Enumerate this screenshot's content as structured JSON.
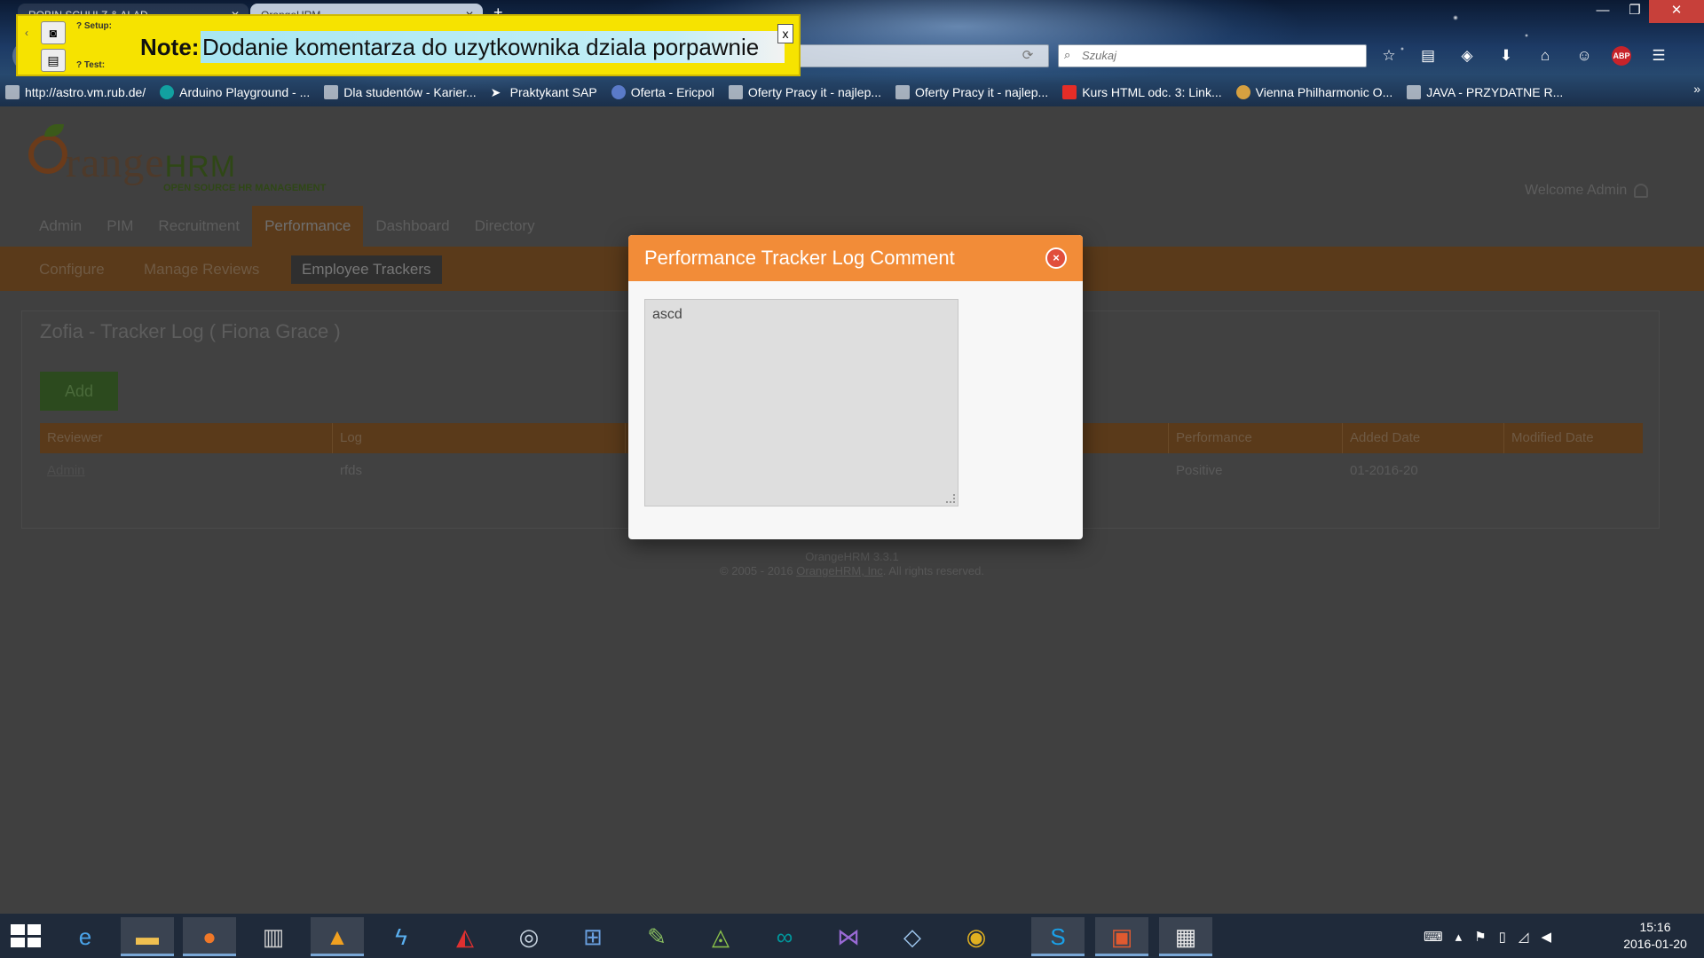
{
  "browser": {
    "tabs": [
      {
        "title": "ROBIN SCHULZ & ALAD..."
      },
      {
        "title": "OrangeHRM"
      }
    ],
    "new_tab": "+",
    "window_controls": {
      "minimize": "—",
      "maximize": "❐",
      "close": "✕"
    },
    "search_placeholder": "Szukaj",
    "bookmarks": [
      {
        "label": "http://astro.vm.rub.de/",
        "icon": "page-icon"
      },
      {
        "label": "Arduino Playground - ...",
        "icon": "arduino-icon"
      },
      {
        "label": "Dla studentów - Karier...",
        "icon": "page-icon"
      },
      {
        "label": "Praktykant SAP",
        "icon": "arrow-icon"
      },
      {
        "label": "Oferta - Ericpol",
        "icon": "butterfly-icon"
      },
      {
        "label": "Oferty Pracy it - najlep...",
        "icon": "page-icon"
      },
      {
        "label": "Oferty Pracy it - najlep...",
        "icon": "page-icon"
      },
      {
        "label": "Kurs HTML odc. 3: Link...",
        "icon": "youtube-icon"
      },
      {
        "label": "Vienna Philharmonic O...",
        "icon": "orb-icon"
      },
      {
        "label": "JAVA - PRZYDATNE R...",
        "icon": "page-icon"
      }
    ],
    "bookmarks_more": "»"
  },
  "note": {
    "setup_label": "? Setup:",
    "test_label": "? Test:",
    "label": "Note:",
    "text": "Dodanie komentarza do uzytkownika dziala porpawnie",
    "close": "x"
  },
  "app": {
    "logo_word": "range",
    "logo_hrm": "HRM",
    "logo_tagline": "OPEN SOURCE HR MANAGEMENT",
    "welcome": "Welcome Admin",
    "main_menu": [
      "Admin",
      "PIM",
      "Recruitment",
      "Performance",
      "Dashboard",
      "Directory"
    ],
    "sub_menu": [
      "Configure",
      "Manage Reviews",
      "Employee Trackers"
    ],
    "panel_title": "Zofia - Tracker Log ( Fiona Grace )",
    "add_button": "Add",
    "table": {
      "headers": [
        "Reviewer",
        "Log",
        "",
        "Performance",
        "Added Date",
        "Modified Date"
      ],
      "rows": [
        [
          "Admin",
          "rfds",
          "",
          "Positive",
          "01-2016-20",
          ""
        ]
      ]
    },
    "footer_version": "OrangeHRM 3.3.1",
    "footer_copy_prefix": "© 2005 - 2016",
    "footer_company": "OrangeHRM, Inc",
    "footer_copy_suffix": ". All rights reserved."
  },
  "modal": {
    "title": "Performance Tracker Log Comment",
    "close": "×",
    "comment_value": "ascd"
  },
  "taskbar": {
    "apps": [
      "windows-start",
      "internet-explorer",
      "file-explorer",
      "firefox",
      "media-app",
      "vlc-app",
      "lightning-app",
      "acrobat-reader",
      "disc-app",
      "network-app",
      "notepad-app",
      "android-studio",
      "arduino-ide",
      "visual-studio",
      "virtualbox",
      "chrome",
      "skype",
      "powerpoint",
      "selenium-ide"
    ],
    "clock_time": "15:16",
    "clock_date": "2016-01-20"
  },
  "colors": {
    "modal_header": "#f28c38",
    "note_bg": "#f6e300",
    "menu_accent_dimmed": "#5a3a1a"
  }
}
